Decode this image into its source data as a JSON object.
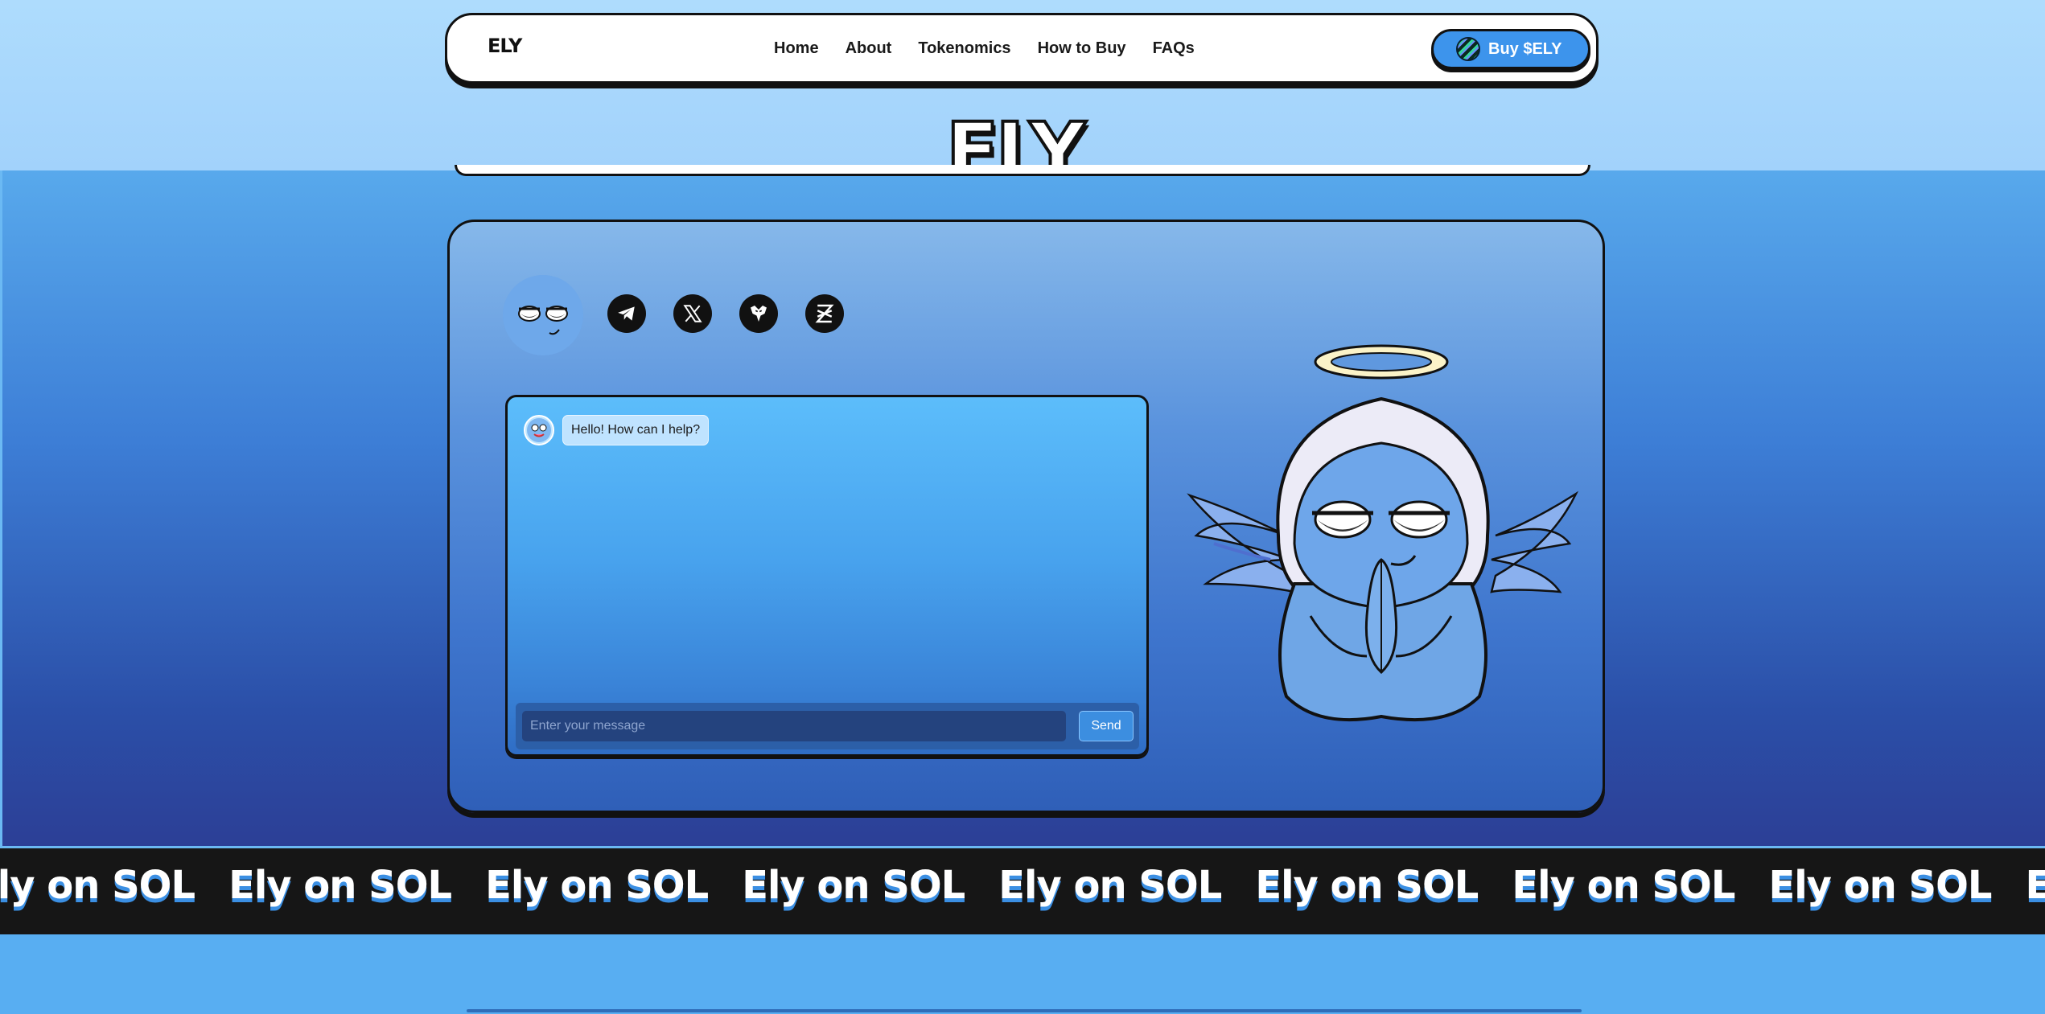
{
  "nav": {
    "brand": "ELY",
    "links": [
      "Home",
      "About",
      "Tokenomics",
      "How to Buy",
      "FAQs"
    ],
    "buy_label": "Buy $ELY"
  },
  "hero": {
    "title": "ELY"
  },
  "socials": [
    "telegram-icon",
    "x-icon",
    "eagle-icon",
    "dexscreener-icon"
  ],
  "chat": {
    "greeting": "Hello! How can I help?",
    "input_placeholder": "Enter your message",
    "input_value": "",
    "send_label": "Send"
  },
  "marquee": {
    "text": "Ely on SOL"
  },
  "colors": {
    "accent": "#3d94ec",
    "background_top": "#a8d6fb",
    "background_bottom": "#2c3f96",
    "marquee_bg": "#161616"
  }
}
